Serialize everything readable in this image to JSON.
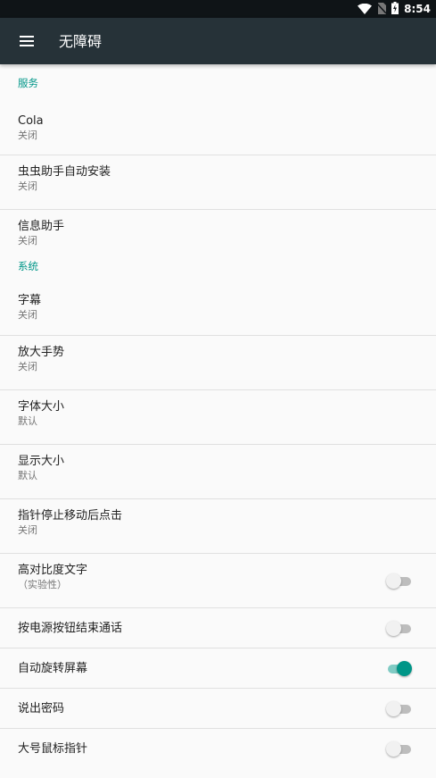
{
  "status_bar": {
    "time": "8:54"
  },
  "app_bar": {
    "title": "无障碍"
  },
  "sections": {
    "services": {
      "header": "服务",
      "items": [
        {
          "title": "Cola",
          "summary": "关闭"
        },
        {
          "title": "虫虫助手自动安装",
          "summary": "关闭"
        },
        {
          "title": "信息助手",
          "summary": "关闭"
        }
      ]
    },
    "system": {
      "header": "系统",
      "items": [
        {
          "title": "字幕",
          "summary": "关闭"
        },
        {
          "title": "放大手势",
          "summary": "关闭"
        },
        {
          "title": "字体大小",
          "summary": "默认"
        },
        {
          "title": "显示大小",
          "summary": "默认"
        },
        {
          "title": "指针停止移动后点击",
          "summary": "关闭"
        }
      ],
      "toggles": [
        {
          "title": "高对比度文字",
          "summary": "（实验性）",
          "on": false
        },
        {
          "title": "按电源按钮结束通话",
          "on": false
        },
        {
          "title": "自动旋转屏幕",
          "on": true
        },
        {
          "title": "说出密码",
          "on": false
        },
        {
          "title": "大号鼠标指针",
          "on": false
        }
      ]
    }
  },
  "colors": {
    "accent": "#009688",
    "app_bar": "#263238",
    "status_bar": "#0f1417"
  }
}
